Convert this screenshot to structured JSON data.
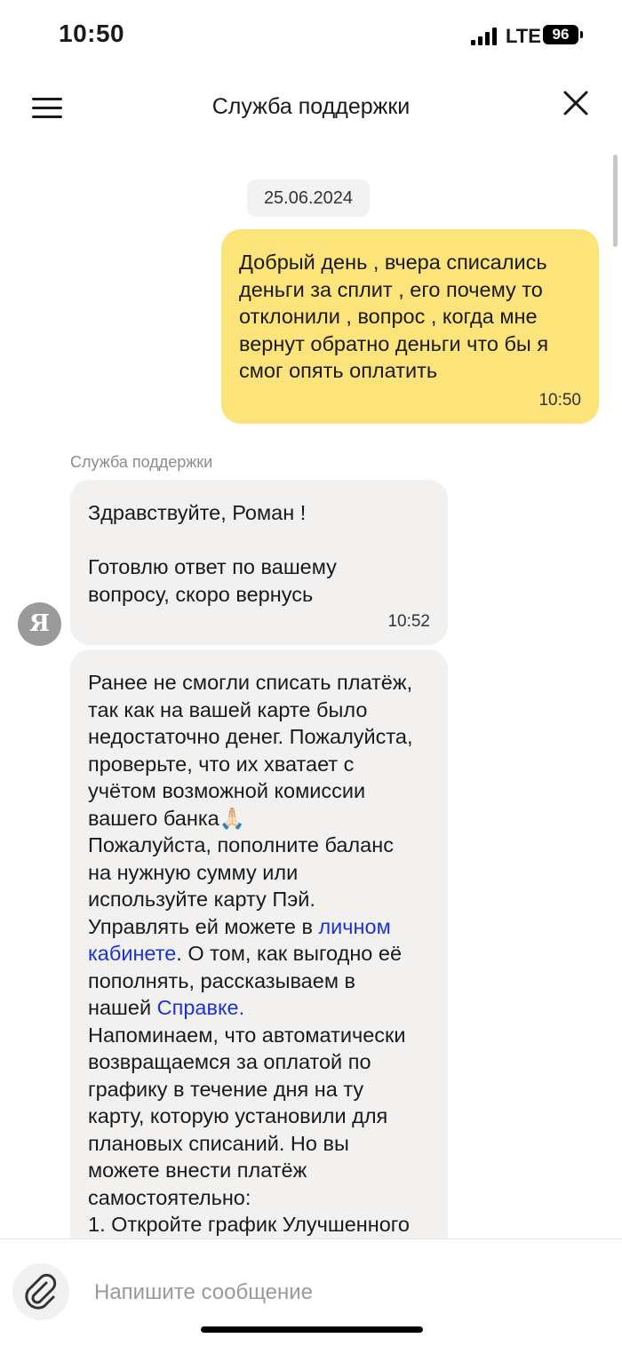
{
  "status_bar": {
    "time": "10:50",
    "network": "LTE",
    "battery": "96"
  },
  "header": {
    "title": "Служба поддержки"
  },
  "chat": {
    "date": "25.06.2024",
    "outgoing": {
      "text": "Добрый день , вчера списались\nденьги за сплит , его почему то\nотклонили , вопрос , когда мне\nвернут обратно деньги что бы я\nсмог опять оплатить",
      "time": "10:50"
    },
    "sender_name": "Служба поддержки",
    "avatar_letter": "Я",
    "incoming_1": {
      "text": "Здравствуйте, Роман !\n\nГотовлю ответ по вашему\nвопросу, скоро вернусь",
      "time": "10:52"
    },
    "incoming_2": {
      "part1": "Ранее не смогли списать платёж,\nтак как на вашей карте было\nнедостаточно денег. Пожалуйста,\nпроверьте, что их хватает с\nучётом возможной комиссии\nвашего банка🙏🏻\nПожалуйста, пополните баланс\nна нужную сумму или\nиспользуйте карту Пэй.\nУправлять ей можете в ",
      "link1": "личном\nкабинете",
      "part2": ". О том, как выгодно её\nпополнять, рассказываем в\nнашей ",
      "link2": "Справке.",
      "part3": "\nНапоминаем, что автоматически\nвозвращаемся за оплатой по\nграфику в течение дня на ту\nкарту, которую установили для\nплановых списаний. Но вы\nможете внести платёж\nсамостоятельно:\n1. Откройте график Улучшенного"
    }
  },
  "composer": {
    "placeholder": "Напишите сообщение"
  }
}
